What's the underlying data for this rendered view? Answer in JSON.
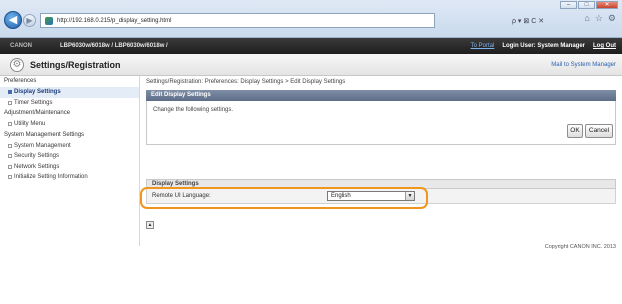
{
  "browser": {
    "url": "http://192.168.0.215/p_display_setting.html",
    "window_controls": [
      "–",
      "□",
      "✕"
    ],
    "search_glyphs": "ρ ▾ ⊠ C ✕",
    "tool_icons": [
      "home-icon",
      "star-icon",
      "gear-icon"
    ]
  },
  "printer_strip": {
    "brand": "CANON",
    "model": "LBP6030w/6018w / LBP6030w/6018w /",
    "portal_link": "To Portal",
    "login_user": "Login User: System Manager",
    "logout": "Log Out"
  },
  "header": {
    "title": "Settings/Registration",
    "mail_link": "Mail to System Manager"
  },
  "sidebar": {
    "groups": [
      {
        "label": "Preferences",
        "items": [
          {
            "label": "Display Settings",
            "active": true
          },
          {
            "label": "Timer Settings",
            "active": false
          }
        ]
      },
      {
        "label": "Adjustment/Maintenance",
        "items": [
          {
            "label": "Utility Menu",
            "active": false
          }
        ]
      },
      {
        "label": "System Management Settings",
        "items": [
          {
            "label": "System Management",
            "active": false
          },
          {
            "label": "Security Settings",
            "active": false
          },
          {
            "label": "Network Settings",
            "active": false
          },
          {
            "label": "Initialize Setting Information",
            "active": false
          }
        ]
      }
    ]
  },
  "main": {
    "breadcrumb": "Settings/Registration: Preferences: Display Settings > Edit Display Settings",
    "panel_title": "Edit Display Settings",
    "instruction": "Change the following settings.",
    "ok_label": "OK",
    "cancel_label": "Cancel",
    "section_title": "Display Settings",
    "field_label": "Remote UI Language:",
    "field_value": "English",
    "top_link": "▲"
  },
  "footer": {
    "copyright": "Copyright CANON INC. 2013"
  },
  "colors": {
    "highlight": "#f0961e",
    "panel_head": "#5d6d88",
    "link": "#2a62b0"
  }
}
